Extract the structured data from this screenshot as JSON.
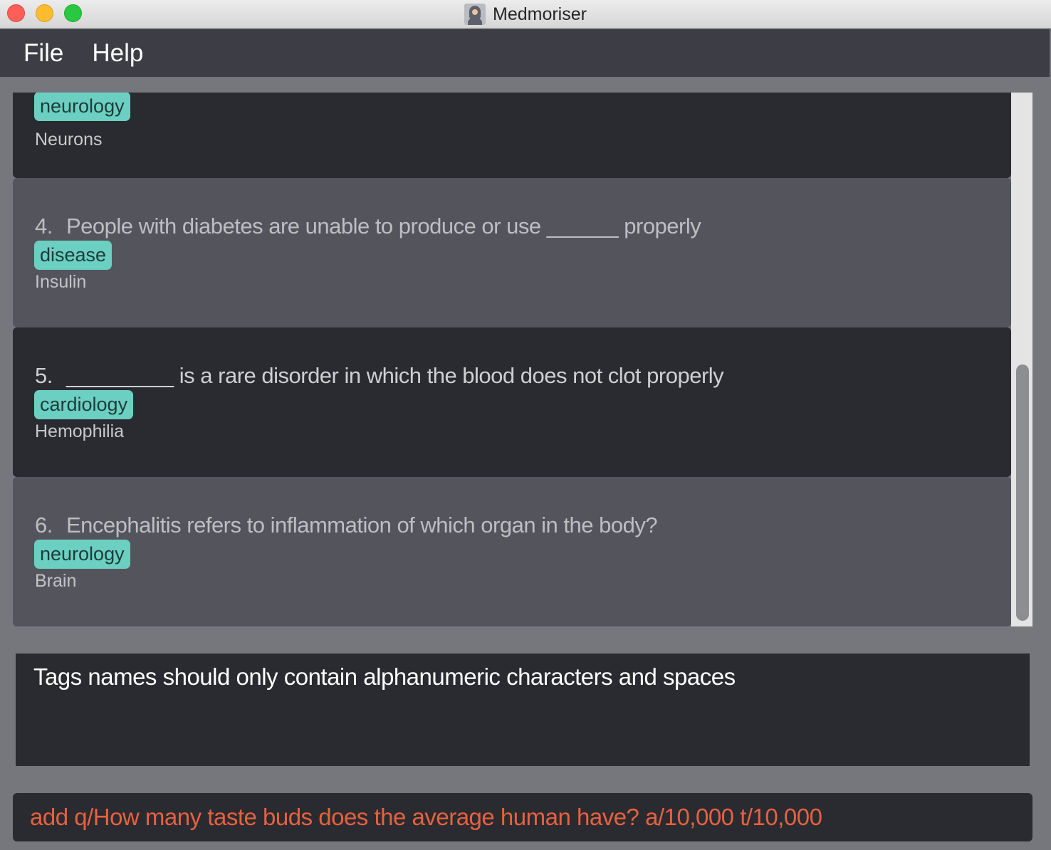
{
  "window": {
    "title": "Medmoriser",
    "app_icon": "brain-head-icon"
  },
  "menu": {
    "items": [
      "File",
      "Help"
    ]
  },
  "cards": [
    {
      "number": "",
      "question": "",
      "tag": "neurology",
      "answer": "Neurons"
    },
    {
      "number": "4.",
      "question": "People with diabetes are unable to produce or use ______ properly",
      "tag": "disease",
      "answer": "Insulin"
    },
    {
      "number": "5.",
      "question": "_________ is a rare disorder in which the blood does not clot properly",
      "tag": "cardiology",
      "answer": "Hemophilia"
    },
    {
      "number": "6.",
      "question": "Encephalitis refers to inflammation of which organ in the body?",
      "tag": "neurology",
      "answer": "Brain"
    }
  ],
  "result": {
    "message": "Tags names should only contain alphanumeric characters and spaces"
  },
  "command": {
    "value": "add q/How many taste buds does the average human have? a/10,000 t/10,000"
  },
  "colors": {
    "tag_bg": "#6bcfc1",
    "error_text": "#e7613f",
    "card_dark": "#2a2b30",
    "card_light": "#54555c",
    "menubar": "#3d3e45"
  }
}
